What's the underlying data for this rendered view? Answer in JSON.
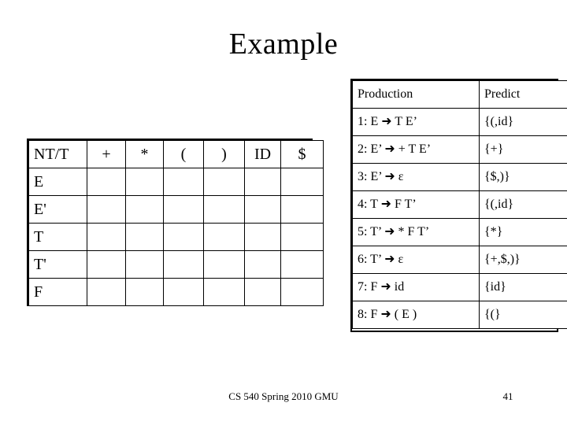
{
  "slide": {
    "title": "Example",
    "footer": "CS 540 Spring 2010 GMU",
    "page_number": "41",
    "background_color": "#ffffff",
    "text_color": "#000000",
    "border_color": "#000000"
  },
  "parse_table": {
    "columns": [
      "NT/T",
      "+",
      "*",
      "(",
      ")",
      "ID",
      "$"
    ],
    "rows": [
      {
        "label": "E",
        "cells": [
          "",
          "",
          "",
          "",
          "",
          ""
        ]
      },
      {
        "label": "E'",
        "cells": [
          "",
          "",
          "",
          "",
          "",
          ""
        ]
      },
      {
        "label": "T",
        "cells": [
          "",
          "",
          "",
          "",
          "",
          ""
        ]
      },
      {
        "label": "T'",
        "cells": [
          "",
          "",
          "",
          "",
          "",
          ""
        ]
      },
      {
        "label": "F",
        "cells": [
          "",
          "",
          "",
          "",
          "",
          ""
        ]
      }
    ]
  },
  "production_table": {
    "columns": [
      "Production",
      "Predict"
    ],
    "rows": [
      {
        "production": "1: E ➜ T E’",
        "predict": "{(,id}"
      },
      {
        "production": "2: E’ ➜ + T E’",
        "predict": "{+}"
      },
      {
        "production": "3: E’ ➜ ε",
        "predict": "{$,)}"
      },
      {
        "production": "4: T ➜ F T’",
        "predict": "{(,id}"
      },
      {
        "production": "5: T’ ➜ * F T’",
        "predict": "{*}"
      },
      {
        "production": "6: T’ ➜ ε",
        "predict": "{+,$,)}"
      },
      {
        "production": "7: F ➜ id",
        "predict": "{id}"
      },
      {
        "production": "8: F ➜ ( E )",
        "predict": "{(}"
      }
    ]
  }
}
